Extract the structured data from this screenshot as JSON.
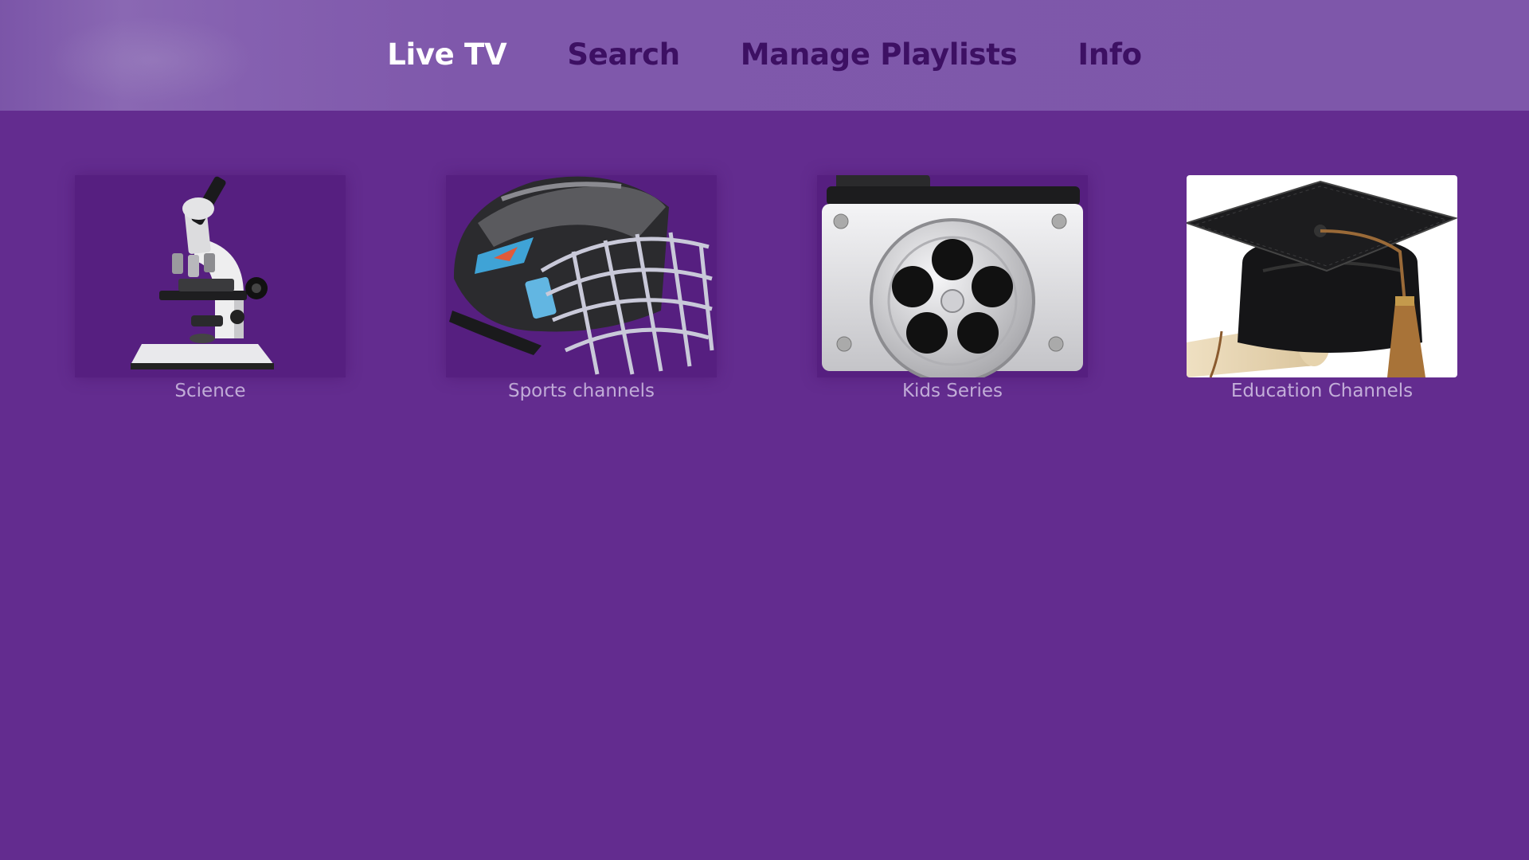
{
  "nav": {
    "tabs": [
      {
        "label": "Live TV",
        "active": true
      },
      {
        "label": "Search",
        "active": false
      },
      {
        "label": "Manage Playlists",
        "active": false
      },
      {
        "label": "Info",
        "active": false
      }
    ]
  },
  "categories": [
    {
      "label": "Science",
      "icon": "microscope-icon"
    },
    {
      "label": "Sports channels",
      "icon": "hockey-helmet-icon"
    },
    {
      "label": "Kids Series",
      "icon": "film-reel-folder-icon"
    },
    {
      "label": "Education Channels",
      "icon": "graduation-cap-icon"
    }
  ],
  "colors": {
    "background": "#632c8f",
    "topbar": "#7e57aa",
    "tab_inactive": "#3d1063",
    "tab_active": "#ffffff",
    "tile_label": "#c3aed9"
  }
}
